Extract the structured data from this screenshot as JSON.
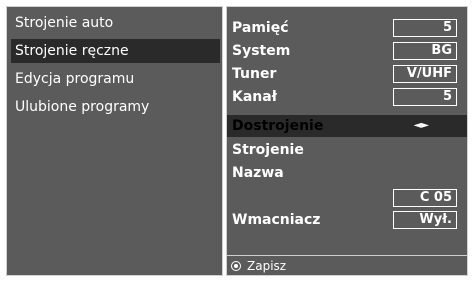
{
  "left_menu": {
    "items": [
      {
        "label": "Strojenie auto"
      },
      {
        "label": "Strojenie ręczne"
      },
      {
        "label": "Edycja programu"
      },
      {
        "label": "Ulubione programy"
      }
    ],
    "selected_index": 1
  },
  "settings": {
    "pamiec": {
      "label": "Pamięć",
      "value": "5"
    },
    "system": {
      "label": "System",
      "value": "BG"
    },
    "tuner": {
      "label": "Tuner",
      "value": "V/UHF"
    },
    "kanal": {
      "label": "Kanał",
      "value": "5"
    },
    "dostrojenie": {
      "label": "Dostrojenie",
      "arrows": "◄►"
    },
    "strojenie": {
      "label": "Strojenie"
    },
    "nazwa": {
      "label": "Nazwa",
      "value": "C 05"
    },
    "wmacniacz": {
      "label": "Wmacniacz",
      "value": "Wył."
    }
  },
  "footer": {
    "save_label": "Zapisz"
  },
  "colors": {
    "panel": "#5b5b5b",
    "selected": "#2a2a2a",
    "text": "#ffffff"
  }
}
